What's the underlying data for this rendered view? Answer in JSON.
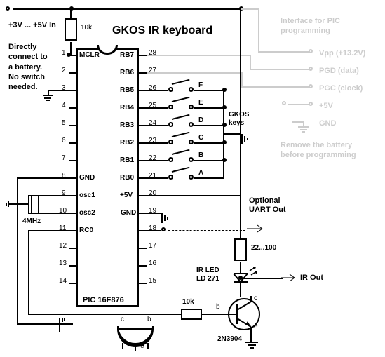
{
  "title": "GKOS IR keyboard",
  "power_label": "+3V ... +5V In",
  "directly_text": "Directly\nconnect to\na battery.\nNo switch\nneeded.",
  "interface_label": "Interface for PIC\nprogramming",
  "vpp_label": "Vpp (+13.2V)",
  "pgd_label": "PGD (data)",
  "pgc_label": "PGC (clock)",
  "prog_5v": "+5V",
  "prog_gnd": "GND",
  "remove_battery": "Remove the battery\nbefore programming",
  "gkos_keys_label": "GKOS\nkeys",
  "uart_label": "Optional\nUART Out",
  "irled_label": "IR LED\nLD 271",
  "irout_label": "IR Out",
  "r1_label": "10k",
  "r2_label": "10k",
  "r3_label": "22...100",
  "crystal_label": "4MHz",
  "transistor_label": "2N3904",
  "t_b": "b",
  "t_c": "c",
  "t_e": "e",
  "chip_name": "PIC 16F876",
  "mclr": "MCLR",
  "gnd_pin": "GND",
  "osc1": "osc1",
  "osc2": "osc2",
  "rc0": "RC0",
  "plus5v": "+5V",
  "chip_gnd": "GND",
  "rb7": "RB7",
  "rb6": "RB6",
  "rb5": "RB5",
  "rb4": "RB4",
  "rb3": "RB3",
  "rb2": "RB2",
  "rb1": "RB1",
  "rb0": "RB0",
  "keyA": "A",
  "keyB": "B",
  "keyC": "C",
  "keyD": "D",
  "keyE": "E",
  "keyF": "F",
  "chart_data": {
    "type": "diagram",
    "component": "electronic schematic",
    "mcu": {
      "part": "PIC 16F876",
      "pins": 28
    },
    "left_pins": [
      "MCLR",
      "",
      "",
      "",
      "",
      "",
      "",
      "GND",
      "osc1",
      "osc2",
      "RC0",
      "",
      "",
      ""
    ],
    "right_pins": [
      "RB7",
      "RB6",
      "RB5",
      "RB4",
      "RB3",
      "RB2",
      "RB1",
      "RB0",
      "+5V",
      "GND",
      "",
      "",
      "",
      ""
    ],
    "crystal_freq_mhz": 4,
    "resistors": [
      {
        "name": "R1",
        "value_ohm": 10000,
        "label": "10k"
      },
      {
        "name": "R2",
        "value_ohm": 10000,
        "label": "10k"
      },
      {
        "name": "R3",
        "range_ohm": [
          22,
          100
        ],
        "label": "22...100"
      }
    ],
    "transistor": "2N3904",
    "ir_led": "LD 271",
    "supply_v_range": [
      3,
      5
    ],
    "gkos_keys": [
      "A",
      "B",
      "C",
      "D",
      "E",
      "F"
    ],
    "key_pin_map": {
      "F": 26,
      "E": 25,
      "D": 24,
      "C": 23,
      "B": 22,
      "A": 21
    },
    "programming_lines": [
      "Vpp +13.2V",
      "PGD",
      "PGC",
      "+5V",
      "GND"
    ]
  }
}
